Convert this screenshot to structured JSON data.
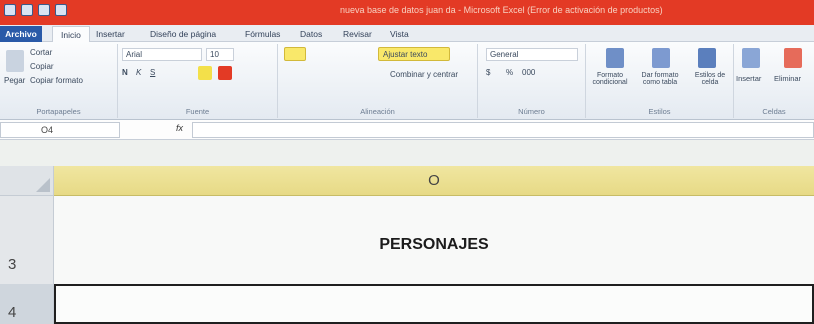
{
  "titlebar": {
    "title": "nueva base de datos juan da - Microsoft Excel (Error de activación de productos)"
  },
  "tabs": [
    "Archivo",
    "Inicio",
    "Insertar",
    "Diseño de página",
    "Fórmulas",
    "Datos",
    "Revisar",
    "Vista"
  ],
  "ribbon": {
    "clipboard": {
      "paste": "Pegar",
      "cut": "Cortar",
      "copy": "Copiar",
      "format_painter": "Copiar formato",
      "label": "Portapapeles"
    },
    "font": {
      "name": "Arial",
      "size": "10",
      "bold": "N",
      "italic": "K",
      "underline": "S",
      "label": "Fuente"
    },
    "alignment": {
      "wrap": "Ajustar texto",
      "merge": "Combinar y centrar",
      "label": "Alineación"
    },
    "number": {
      "format": "General",
      "currency": "$",
      "percent": "%",
      "thousands": "000",
      "label": "Número"
    },
    "styles": {
      "conditional": "Formato condicional",
      "table": "Dar formato como tabla",
      "cell_styles": "Estilos de celda",
      "label": "Estilos"
    },
    "cells": {
      "insert": "Insertar",
      "delete": "Eliminar",
      "label": "Celdas"
    }
  },
  "formula_bar": {
    "name_box": "O4",
    "fx": "fx",
    "value": ""
  },
  "sheet": {
    "column_header": "O",
    "rows": [
      {
        "num": "3",
        "value": "PERSONAJES"
      },
      {
        "num": "4",
        "value": ""
      }
    ]
  },
  "colors": {
    "titlebar": "#e33a25",
    "file_tab": "#2a5aa8",
    "column_header": "#e7da86"
  }
}
